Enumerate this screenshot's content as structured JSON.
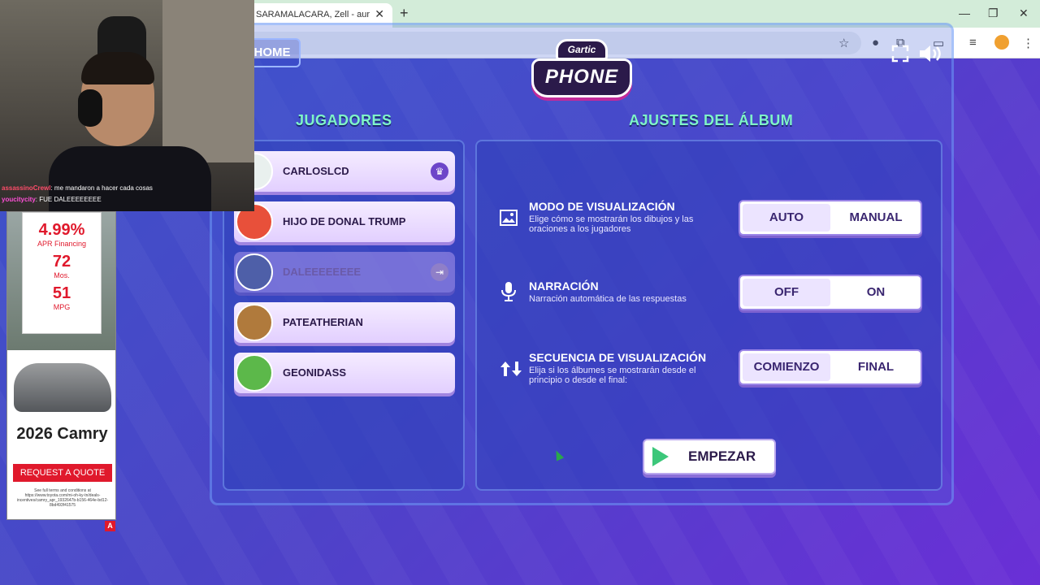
{
  "browser": {
    "tab_title": "SARAMALACARA, Zell - aura ta",
    "tab_close": "✕",
    "new_tab": "+",
    "window_controls": [
      "—",
      "❐",
      "✕"
    ]
  },
  "game": {
    "home_label": "HOME",
    "logo_top": "Gartic",
    "logo_bottom": "PHONE",
    "players_title": "JUGADORES",
    "settings_title": "AJUSTES DEL ÁLBUM",
    "players": [
      {
        "name": "CARLOSLCD",
        "avatar_color": "#e9f0ee",
        "badge": "crown",
        "host": true
      },
      {
        "name": "HIJO DE DONAL TRUMP",
        "avatar_color": "#e8503a",
        "badge": "",
        "host": false
      },
      {
        "name": "DALEEEEEEEE",
        "avatar_color": "#4e5fa8",
        "badge": "exit",
        "host": false
      },
      {
        "name": "PATEATHERIAN",
        "avatar_color": "#b07a3c",
        "badge": "",
        "host": false
      },
      {
        "name": "GEONIDASS",
        "avatar_color": "#5cb84a",
        "badge": "",
        "host": false
      }
    ],
    "settings": [
      {
        "icon": "image-icon",
        "title": "MODO DE VISUALIZACIÓN",
        "desc": "Elige cómo se mostrarán los dibujos y las oraciones a los jugadores",
        "options": [
          "AUTO",
          "MANUAL"
        ],
        "selected": "AUTO"
      },
      {
        "icon": "microphone-icon",
        "title": "NARRACIÓN",
        "desc": "Narración automática de las respuestas",
        "options": [
          "OFF",
          "ON"
        ],
        "selected": "OFF"
      },
      {
        "icon": "sort-arrows-icon",
        "title": "SECUENCIA DE VISUALIZACIÓN",
        "desc": "Elija si los álbumes se mostrarán desde el principio o desde el final:",
        "options": [
          "COMIENZO",
          "FINAL"
        ],
        "selected": "COMIENZO"
      }
    ],
    "start_label": "EMPEZAR"
  },
  "overlay": {
    "chat": [
      {
        "user": "assassinoCrewl",
        "message": ": me mandaron a hacer cada cosas"
      },
      {
        "user": "youcitycity",
        "message": ": FUE DALEEEEEEEE"
      }
    ]
  },
  "ad": {
    "rate": "4.99%",
    "rate_label": "APR Financing",
    "months": "72",
    "months_label": "Mos.",
    "mpg": "51",
    "mpg_label": "MPG",
    "model": "2026 Camry",
    "cta": "REQUEST A QUOTE",
    "fine_print": "See full terms and conditions at https://www.toyota.com/mi-oh-ky-tn/deals-incentives/camry_apr_1932647b-b156-464e-bd12-8bd493f41575",
    "badge": "A"
  },
  "colors": {
    "accent_green": "#7ff5c8",
    "selected_option": "#ece4ff",
    "play_green": "#3cc77a",
    "ad_red": "#e0192c"
  }
}
